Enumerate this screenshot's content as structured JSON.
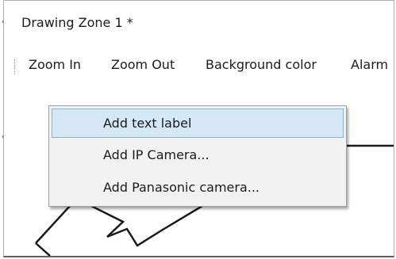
{
  "window": {
    "title": "Drawing Zone 1 *"
  },
  "toolbar": {
    "items": [
      {
        "label": "Zoom In"
      },
      {
        "label": "Zoom Out"
      },
      {
        "label": "Background color"
      },
      {
        "label": "Alarm"
      }
    ]
  },
  "context_menu": {
    "items": [
      {
        "label": "Add text label",
        "highlighted": true
      },
      {
        "label": "Add IP Camera..."
      },
      {
        "label": "Add Panasonic camera..."
      }
    ]
  },
  "colors": {
    "menu_highlight_bg": "#d5e8f8",
    "menu_highlight_border": "#7fb3e6",
    "menu_bg": "#f2f2f2",
    "drawing_stroke": "#1a1a1a"
  }
}
